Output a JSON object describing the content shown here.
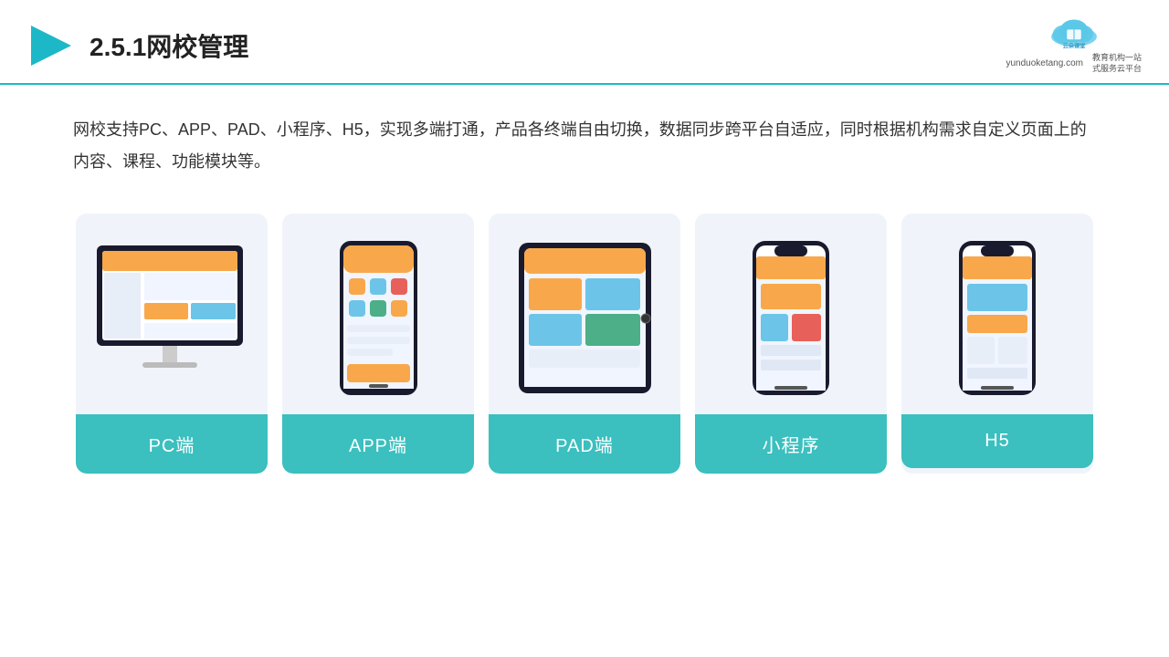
{
  "header": {
    "title": "2.5.1网校管理",
    "logo_url": "yunduoketang.com",
    "logo_slogan": "教育机构一站\n式服务云平台"
  },
  "description": {
    "text": "网校支持PC、APP、PAD、小程序、H5，实现多端打通，产品各终端自由切换，数据同步跨平台自适应，同时根据机构需求自定义页面上的内容、课程、功能模块等。"
  },
  "cards": [
    {
      "id": "pc",
      "label": "PC端",
      "device": "pc"
    },
    {
      "id": "app",
      "label": "APP端",
      "device": "phone"
    },
    {
      "id": "pad",
      "label": "PAD端",
      "device": "tablet"
    },
    {
      "id": "miniapp",
      "label": "小程序",
      "device": "phone-notch"
    },
    {
      "id": "h5",
      "label": "H5",
      "device": "phone-notch2"
    }
  ],
  "accent_color": "#3bbfbf"
}
